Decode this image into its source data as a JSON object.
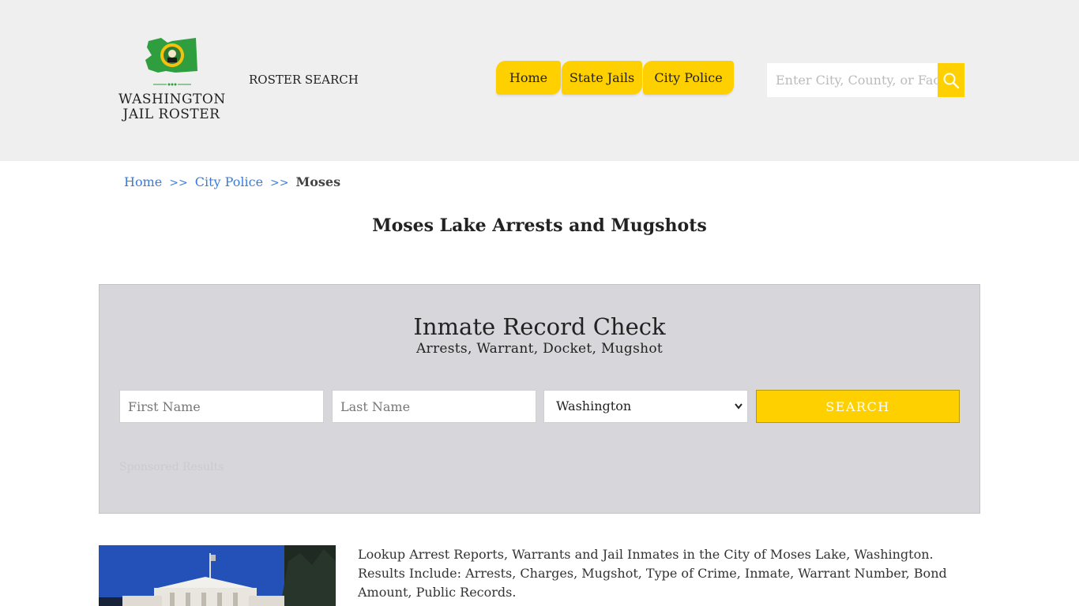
{
  "brand": {
    "logo_line1": "WASHINGTON",
    "logo_line2": "JAIL ROSTER",
    "tagline": "ROSTER SEARCH",
    "flag_color": "#2e9e3e",
    "accent_color": "#ffd000"
  },
  "nav": {
    "items": [
      {
        "label": "Home"
      },
      {
        "label": "State Jails"
      },
      {
        "label": "City Police"
      }
    ]
  },
  "search": {
    "placeholder": "Enter City, County, or Facility",
    "icon": "search-icon"
  },
  "breadcrumb": {
    "home": "Home",
    "sep1": ">>",
    "city_police": "City Police",
    "sep2": ">>",
    "current": "Moses"
  },
  "page": {
    "title": "Moses Lake Arrests and Mugshots"
  },
  "record_check": {
    "title": "Inmate Record Check",
    "subtitle": "Arrests, Warrant, Docket, Mugshot",
    "first_name_placeholder": "First Name",
    "last_name_placeholder": "Last Name",
    "state_selected": "Washington",
    "search_label": "SEARCH",
    "sponsored": "Sponsored Results"
  },
  "content": {
    "intro": "Lookup Arrest Reports, Warrants and Jail Inmates in the City of Moses Lake, Washington. Results Include: Arrests, Charges, Mugshot, Type of Crime, Inmate, Warrant Number, Bond Amount, Public Records."
  }
}
